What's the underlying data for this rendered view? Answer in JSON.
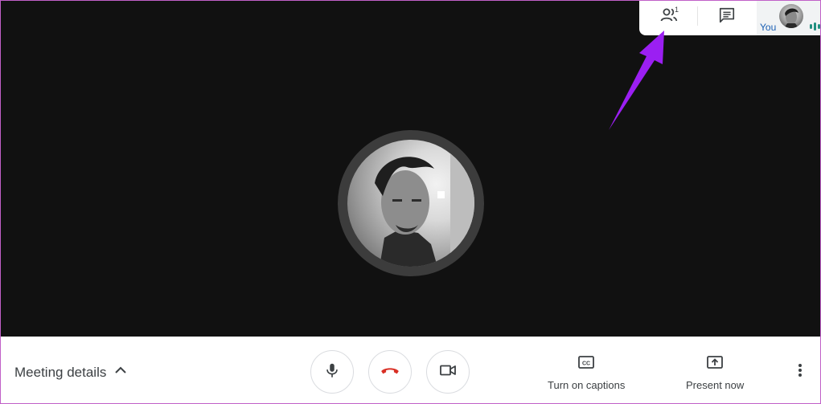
{
  "topbar": {
    "people_icon": "people-icon",
    "people_count": "1",
    "chat_icon": "chat-icon",
    "self_label": "You"
  },
  "stage": {
    "participant_avatar": "participant-avatar"
  },
  "bottombar": {
    "meeting_details_label": "Meeting details",
    "mic_icon": "microphone-icon",
    "end_call_icon": "hang-up-icon",
    "camera_icon": "camera-icon",
    "captions_label": "Turn on captions",
    "present_label": "Present now",
    "more_icon": "more-vert-icon"
  },
  "colors": {
    "stage_bg": "#111111",
    "end_call": "#d93025",
    "annotation_arrow": "#9b1ff2",
    "speaking": "#1e8e7e"
  }
}
